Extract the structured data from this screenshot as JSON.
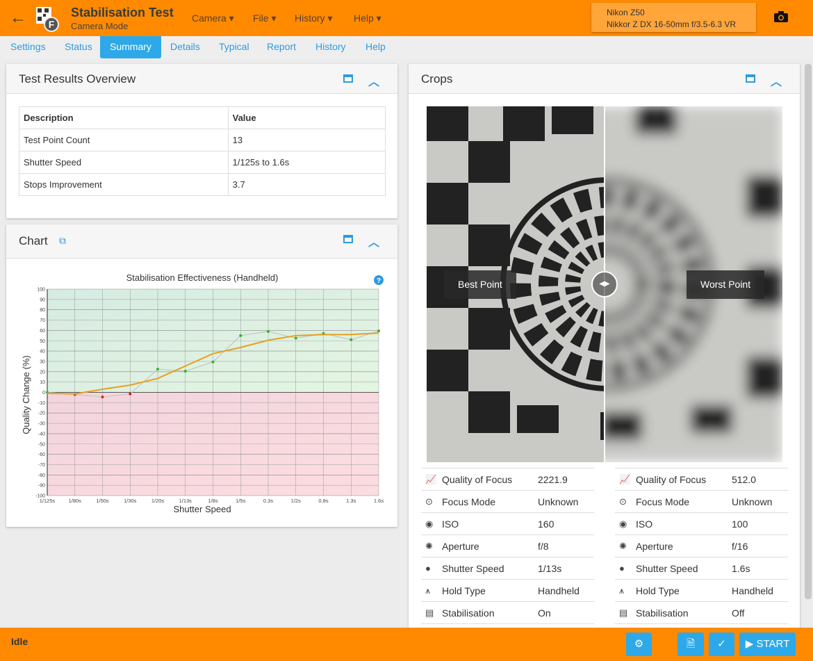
{
  "header": {
    "title": "Stabilisation Test",
    "subtitle": "Camera Mode",
    "menus": [
      "Camera ▾",
      "File ▾",
      "History ▾",
      "Help ▾"
    ],
    "camera": "Nikon Z50",
    "lens": "Nikkor Z DX 16-50mm f/3.5-6.3 VR"
  },
  "tabs": [
    "Settings",
    "Status",
    "Summary",
    "Details",
    "Typical",
    "Report",
    "History",
    "Help"
  ],
  "active_tab": "Summary",
  "overview": {
    "title": "Test Results Overview",
    "headers": [
      "Description",
      "Value"
    ],
    "rows": [
      [
        "Test Point Count",
        "13"
      ],
      [
        "Shutter Speed",
        "1/125s to 1.6s"
      ],
      [
        "Stops Improvement",
        "3.7"
      ]
    ]
  },
  "chart_panel": {
    "title": "Chart"
  },
  "chart_data": {
    "type": "line",
    "title": "Stabilisation Effectiveness (Handheld)",
    "xlabel": "Shutter Speed",
    "ylabel": "Quality Change (%)",
    "ylim": [
      -100,
      100
    ],
    "yticks": [
      100,
      90,
      80,
      70,
      60,
      50,
      40,
      30,
      20,
      10,
      0,
      -10,
      -20,
      -30,
      -40,
      -50,
      -60,
      -70,
      -80,
      -90,
      -100
    ],
    "grid": true,
    "categories": [
      "1/125s",
      "1/80s",
      "1/50s",
      "1/30s",
      "1/20s",
      "1/13s",
      "1/8s",
      "1/5s",
      "0.3s",
      "1/2s",
      "0.8s",
      "1.3s",
      "1.6s"
    ],
    "series": [
      {
        "values": [
          0,
          -2,
          -4.5,
          -1.5,
          22.5,
          20.5,
          29.5,
          55,
          59,
          52.5,
          57,
          51,
          59.5
        ],
        "color": "#c0c8c0"
      },
      {
        "values": [
          -1,
          -1.5,
          3,
          7,
          13.5,
          25.5,
          37.5,
          43.5,
          50.5,
          55,
          56,
          56,
          57.5
        ],
        "color": "#e6a020"
      }
    ],
    "colors": {
      "positive": "#2fb52f",
      "negative": "#e02020"
    }
  },
  "crops": {
    "title": "Crops",
    "best_label": "Best Point",
    "worst_label": "Worst Point",
    "best": [
      [
        "chart-line-icon",
        "Quality of Focus",
        "2221.9"
      ],
      [
        "crosshair-icon",
        "Focus Mode",
        "Unknown"
      ],
      [
        "iso-icon",
        "ISO",
        "160"
      ],
      [
        "aperture-icon",
        "Aperture",
        "f/8"
      ],
      [
        "clock-icon",
        "Shutter Speed",
        "1/13s"
      ],
      [
        "tripod-icon",
        "Hold Type",
        "Handheld"
      ],
      [
        "stabilisation-icon",
        "Stabilisation",
        "On"
      ]
    ],
    "worst": [
      [
        "chart-line-icon",
        "Quality of Focus",
        "512.0"
      ],
      [
        "crosshair-icon",
        "Focus Mode",
        "Unknown"
      ],
      [
        "iso-icon",
        "ISO",
        "100"
      ],
      [
        "aperture-icon",
        "Aperture",
        "f/16"
      ],
      [
        "clock-icon",
        "Shutter Speed",
        "1.6s"
      ],
      [
        "tripod-icon",
        "Hold Type",
        "Handheld"
      ],
      [
        "stabilisation-icon",
        "Stabilisation",
        "Off"
      ]
    ]
  },
  "footer": {
    "status": "Idle",
    "start": "START"
  },
  "colors": {
    "accent": "#ff8a00",
    "primary": "#2da8e8"
  }
}
